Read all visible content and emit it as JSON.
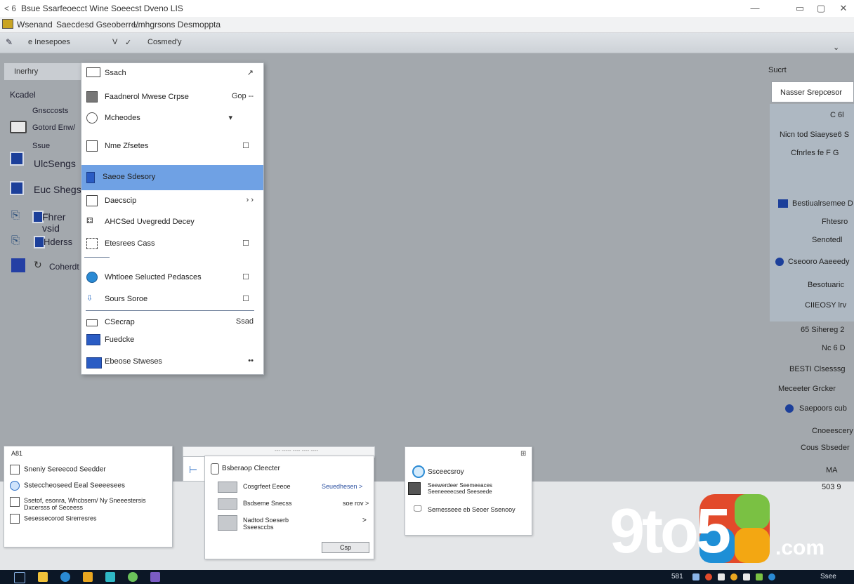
{
  "window": {
    "title": "Bsue Ssarfeoecct Wine Soeecst Dveno LIS",
    "nav": "< 6"
  },
  "menubar": {
    "items": [
      "Wsenand",
      "Saecdesd Gseoberre/",
      "Lmhgrsons Desmoppta"
    ]
  },
  "toolbar": {
    "items": [
      "e Inesepoes",
      "V",
      "Cosmed'y"
    ]
  },
  "left_pane": {
    "header": "Inerhry",
    "items": [
      "Kcadel",
      "Gnsccosts",
      "Gotord Enw/",
      "Ssue",
      "UlcSengs",
      "Euc Shegs",
      "Fhrer vsid",
      "Hderss",
      "Coherdt"
    ]
  },
  "dropdown": {
    "items": [
      {
        "label": "Ssach",
        "right": "↗"
      },
      {
        "label": "Faadnerol Mwese Crpse",
        "right": "Gop --"
      },
      {
        "label": "Mcheodes",
        "right": "▾"
      },
      {
        "label": "Nme Zfsetes",
        "right": "☐"
      },
      {
        "label": "Saeoe Sdesory",
        "right": ""
      },
      {
        "label": "Daecscip",
        "right": "› ›"
      },
      {
        "label": "AHCSed Uvegredd Decey",
        "right": ""
      },
      {
        "label": "Etesrees Cass",
        "right": "☐"
      },
      {
        "label": "Whtloee Selucted Pedasces",
        "right": "☐"
      },
      {
        "label": "Sours Soroe",
        "right": "☐"
      },
      {
        "label": "CSecrap",
        "right": "Ssad"
      },
      {
        "label": "Fuedcke",
        "right": ""
      },
      {
        "label": "Ebeose Stweses",
        "right": "••"
      }
    ]
  },
  "right_pane": {
    "header": "Sucrt",
    "field": "Nasser Srepcesor",
    "items": [
      "C 6l",
      "Nicn tod Siaeyse6 S",
      "Cfnrles fe F G",
      "Bestiualrsemee D",
      "Fhtesro",
      "Senotedl",
      "Cseooro Aaeeedy",
      "Besotuaric",
      "CIIEOSY lrv",
      "65 Sihereg 2",
      "Nc 6 D",
      "BESTI Clsesssg",
      "Meceeter  Grcker",
      "Saepoors cub",
      "Cnoeescery",
      "Cous Sbseder",
      "MA"
    ]
  },
  "panels": {
    "p1": {
      "header": "A81",
      "rows": [
        "Sneniy Sereecod Seedder",
        "Ssteccheoseed Eeal Seeeesees",
        "Ssetof, esonra, Whcbsem/ Ny Sneeestersis Dxcersss of Seceess",
        "Sesessecorod Sirerresres"
      ]
    },
    "p2": {
      "header": "Bsberaop Cleecter",
      "rows": [
        {
          "label": "Cosgrfeet Eeeoe",
          "right": "Seuedhesen >"
        },
        {
          "label": "Bsdseme Snecss",
          "right": "soe rov >"
        },
        {
          "label": "Nadtod Soeserb Sseesccbs",
          "right": ">"
        }
      ],
      "button": "Csp"
    },
    "p3": {
      "header": "Ssceecsroy",
      "rows": [
        "Seewerdeer Seemeeaces Seeneeeecsed Seeseede",
        "Sernesseee eb Seoer Ssenooy"
      ]
    }
  },
  "bottom": {
    "tab_labels": [
      "--- -----  ---- ----  ----"
    ],
    "right_text": "503 9"
  },
  "taskbar": {
    "tray": [
      "581"
    ],
    "clock": "Ssee"
  },
  "watermark": {
    "text": "9to5",
    "suffix": ".com"
  }
}
